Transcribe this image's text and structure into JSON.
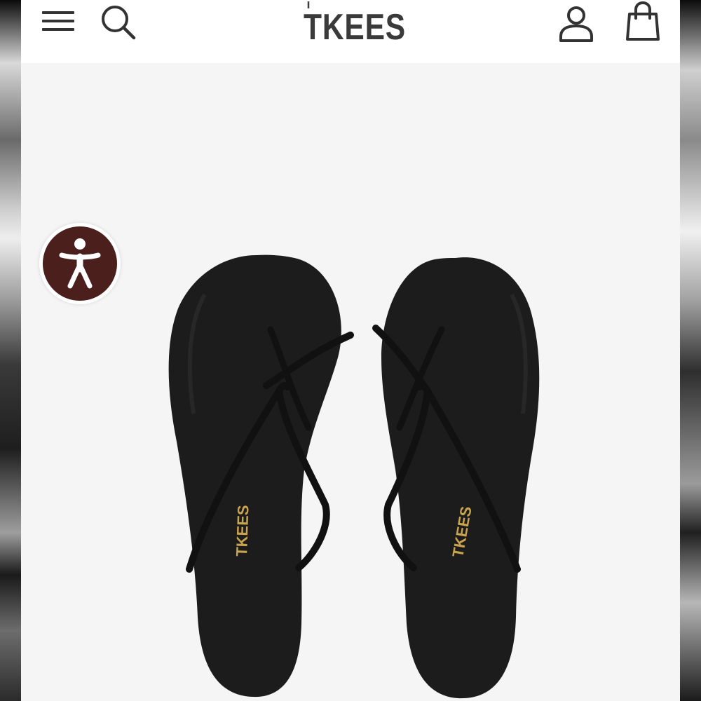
{
  "header": {
    "brand_name": "TKEES",
    "icons": {
      "menu": "hamburger-menu-icon",
      "search": "search-icon",
      "account": "user-account-icon",
      "bag": "shopping-bag-icon"
    }
  },
  "product": {
    "image_subject": "black leather flip flop sandals",
    "footbed_stamp": "TKEES"
  },
  "accessibility": {
    "icon": "accessibility-person-icon"
  },
  "colors": {
    "header_bg": "#ffffff",
    "page_bg": "#f5f5f5",
    "logo": "#3a3a3a",
    "sandal": "#1c1c1c",
    "stamp_gold": "#c9a44f",
    "accessibility_button": "#4a1f1c"
  }
}
